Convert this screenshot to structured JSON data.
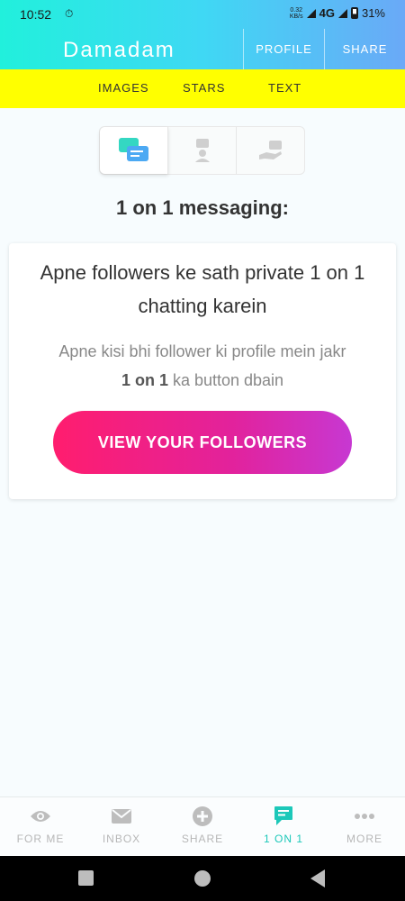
{
  "status": {
    "time": "10:52",
    "speed_top": "0.32",
    "speed_bottom": "KB/s",
    "network": "4G",
    "battery": "31%"
  },
  "header": {
    "app_name": "Damadam",
    "profile_label": "PROFILE",
    "share_label": "SHARE"
  },
  "tabs": [
    {
      "label": "IMAGES"
    },
    {
      "label": "STARS"
    },
    {
      "label": "TEXT"
    }
  ],
  "segments": [
    {
      "icon": "chat-bubbles-icon",
      "active": true
    },
    {
      "icon": "person-message-icon",
      "active": false
    },
    {
      "icon": "hand-message-icon",
      "active": false
    }
  ],
  "main": {
    "heading": "1 on 1 messaging:",
    "card": {
      "title": "Apne followers ke sath private 1 on 1 chatting karein",
      "body_prefix": "Apne kisi bhi follower ki profile mein jakr",
      "body_bold": "1 on 1",
      "body_suffix": " ka button dbain",
      "button_label": "VIEW YOUR FOLLOWERS"
    }
  },
  "bottom_nav": [
    {
      "label": "FOR ME",
      "icon": "eye-icon",
      "active": false
    },
    {
      "label": "INBOX",
      "icon": "envelope-icon",
      "active": false
    },
    {
      "label": "SHARE",
      "icon": "plus-circle-icon",
      "active": false
    },
    {
      "label": "1 ON 1",
      "icon": "chat-icon",
      "active": true
    },
    {
      "label": "MORE",
      "icon": "more-dots-icon",
      "active": false
    }
  ],
  "colors": {
    "accent": "#1cc8b9",
    "tab_bar": "#ffff00",
    "cta_start": "#ff1d6e",
    "cta_end": "#c738d2"
  }
}
